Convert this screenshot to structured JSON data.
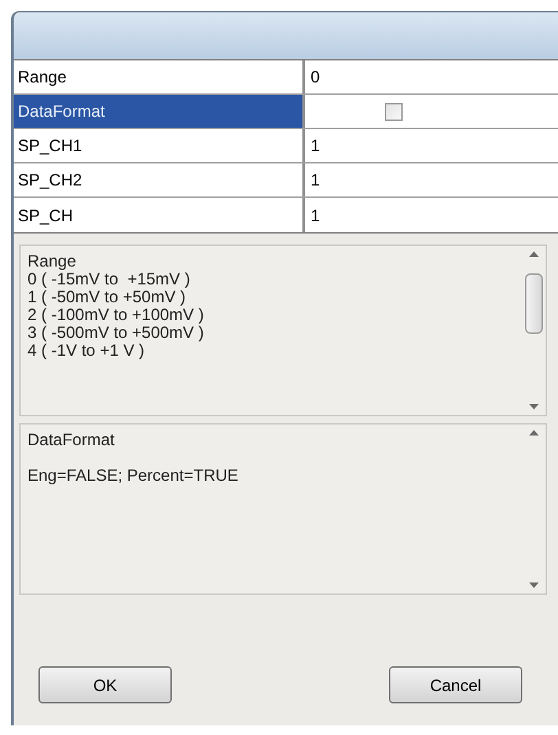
{
  "properties": [
    {
      "name": "Range",
      "kind": "text",
      "value": "0",
      "selected": false
    },
    {
      "name": "DataFormat",
      "kind": "checkbox",
      "checked": false,
      "selected": true
    },
    {
      "name": "SP_CH1",
      "kind": "text",
      "value": "1",
      "selected": false
    },
    {
      "name": "SP_CH2",
      "kind": "text",
      "value": "1",
      "selected": false
    },
    {
      "name": "SP_CH",
      "kind": "text",
      "value": "1",
      "selected": false
    }
  ],
  "descriptions": [
    {
      "title": "Range",
      "lines": [
        "0 ( -15mV to  +15mV )",
        "1 ( -50mV to +50mV )",
        "2 ( -100mV to +100mV )",
        "3 ( -500mV to +500mV )",
        "4 ( -1V to +1 V )"
      ],
      "kind": "list"
    },
    {
      "title": "DataFormat",
      "lines": [
        "Eng=FALSE; Percent=TRUE"
      ],
      "kind": "note"
    }
  ],
  "buttons": [
    "OK",
    "Cancel"
  ]
}
